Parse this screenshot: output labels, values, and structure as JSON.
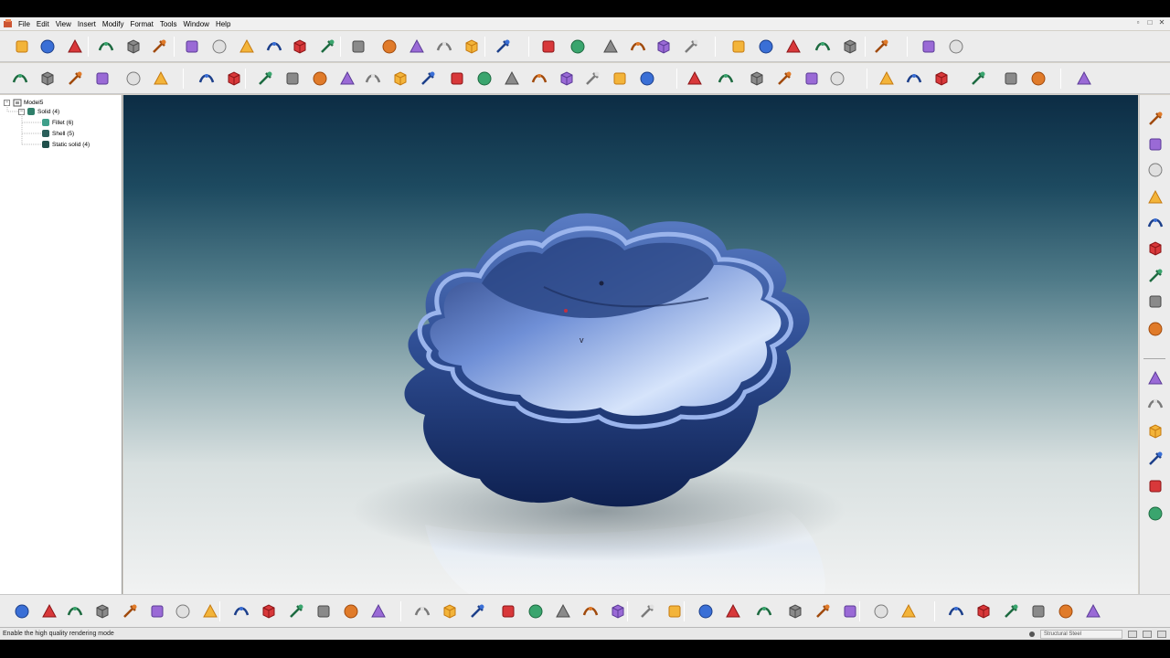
{
  "menu": {
    "items": [
      "File",
      "Edit",
      "View",
      "Insert",
      "Modify",
      "Format",
      "Tools",
      "Window",
      "Help"
    ]
  },
  "tree": {
    "root": "Model5",
    "nodes": [
      {
        "label": "Solid (4)",
        "color": "#2f7f6a"
      },
      {
        "label": "Fillet (6)",
        "color": "#3f9f8a"
      },
      {
        "label": "Shell (5)",
        "color": "#2a5f5a"
      },
      {
        "label": "Static solid (4)",
        "color": "#1f4f4a"
      }
    ]
  },
  "statusbar": {
    "message": "Enable the high quality rendering mode",
    "material": "Structural Steel"
  },
  "icons": {
    "toolbar1": [
      "new-file-icon",
      "open-file-icon",
      "save-icon",
      "undo-icon",
      "redo-icon",
      "clipboard-icon",
      "solid-box-icon",
      "render-sphere-icon",
      "move-icon",
      "zoom-icon",
      "fit-view-icon",
      "pan-view-icon",
      "measure-icon",
      "shade-icon",
      "material-icon",
      "lighting-icon",
      "camera-icon",
      "sketch-tool-icon",
      "delete-red-icon",
      "trim-red-icon",
      "copy-shape-icon",
      "paste-shape-icon",
      "hammer-icon",
      "transform-icon",
      "select-arrow-icon",
      "select-face-icon",
      "select-edge-icon",
      "cube-icon",
      "print-icon",
      "zigzag-icon",
      "wrench-icon",
      "tool-yellow-icon"
    ],
    "toolbar2": [
      "freehand-curve-icon",
      "line-icon",
      "circle-icon",
      "polygon-icon",
      "arc-icon",
      "fillet-curve-icon",
      "spline-icon",
      "pen-icon",
      "bezier-icon",
      "layer-icon",
      "ellipse-icon",
      "project-icon",
      "offset-icon",
      "bottle-icon",
      "surface-icon",
      "sweep-icon",
      "loft-icon",
      "blend-icon",
      "knot-icon",
      "bridge-icon",
      "patch-icon",
      "hook-icon",
      "text-tool-icon",
      "text-frame-icon",
      "grid-icon",
      "dimension-icon",
      "table-icon",
      "note-icon",
      "point-icon",
      "snap-icon",
      "align-icon",
      "section-icon",
      "view-cube-icon",
      "cup-icon",
      "mug-icon",
      "vase-icon"
    ],
    "right": [
      "scissors-icon",
      "cut-icon",
      "slice-icon",
      "hand-icon",
      "shape-orange-icon",
      "split-icon",
      "merge-icon",
      "rotate-icon",
      "extend-icon",
      "snapshot-icon",
      "camera-red-icon",
      "render-red-icon",
      "animate-icon",
      "info-icon",
      "label-icon"
    ],
    "bottom": [
      "extrude-icon",
      "revolve-icon",
      "sweep-solid-icon",
      "loft-solid-icon",
      "thicken-icon",
      "pattern-icon",
      "mirror-icon",
      "shell-icon",
      "draft-icon",
      "rib-icon",
      "hole-icon",
      "thread-icon",
      "boolean-icon",
      "split-body-icon",
      "cylinder-icon",
      "arch-icon",
      "pipe-icon",
      "cone-icon",
      "sphere-green-icon",
      "box-green-icon",
      "torus-icon",
      "prism-icon",
      "ring-orange-icon",
      "disc-orange-icon",
      "slab-icon",
      "frame-icon",
      "plate-icon",
      "wheel-icon",
      "column-icon",
      "barrel-icon",
      "gear-icon",
      "spring-icon",
      "drill-icon",
      "bend-icon",
      "curve-blue-icon",
      "assembly-icon",
      "constraint-icon",
      "connector-icon"
    ]
  },
  "colors": {
    "viewport_top": "#0c2c44",
    "viewport_bottom": "#f4f4f4",
    "bowl": "#3b5ea8",
    "bowl_inner": "#a8c0ee"
  }
}
